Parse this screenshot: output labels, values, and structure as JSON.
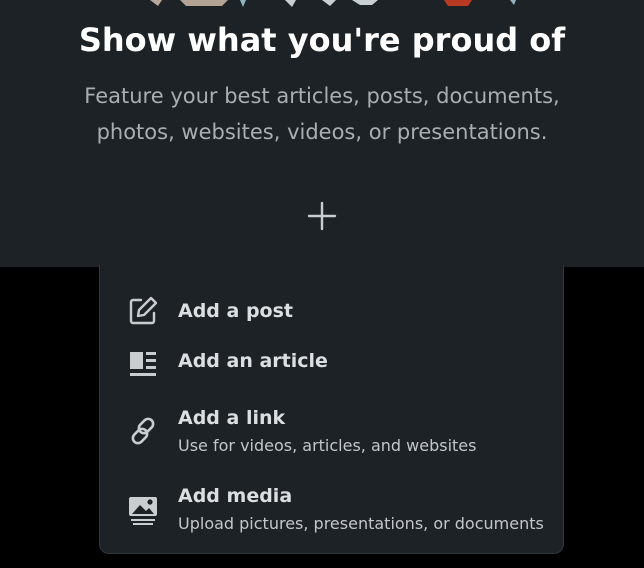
{
  "hero": {
    "headline": "Show what you're proud of",
    "subtitle": "Feature your best articles, posts, documents, photos, websites, videos, or presentations.",
    "add_button_icon": "plus-icon"
  },
  "menu": {
    "items": [
      {
        "id": "post",
        "icon": "pencil-square-icon",
        "title": "Add a post",
        "description": ""
      },
      {
        "id": "article",
        "icon": "article-icon",
        "title": "Add an article",
        "description": ""
      },
      {
        "id": "link",
        "icon": "link-icon",
        "title": "Add a link",
        "description": "Use for videos, articles, and websites"
      },
      {
        "id": "media",
        "icon": "image-icon",
        "title": "Add media",
        "description": "Upload pictures, presentations, or documents"
      }
    ]
  },
  "colors": {
    "card_background": "#1d2226",
    "page_background": "#000000",
    "headline_text": "#ffffff",
    "muted_text": "#a9aeb3",
    "icon": "#c9cdd0"
  }
}
